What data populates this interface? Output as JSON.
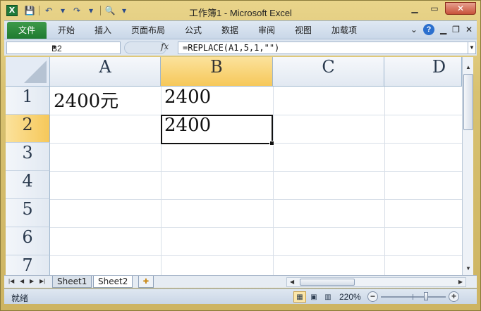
{
  "window": {
    "title": "工作簿1 - Microsoft Excel",
    "app_icon": "X"
  },
  "qat": {
    "save_icon": "💾",
    "undo_icon": "↶",
    "redo_icon": "↷",
    "preview_icon": "🔍"
  },
  "ribbon": {
    "tabs": [
      "文件",
      "开始",
      "插入",
      "页面布局",
      "公式",
      "数据",
      "审阅",
      "视图",
      "加载项"
    ],
    "help": "?"
  },
  "formula_bar": {
    "name_box": "B2",
    "fx_label": "fx",
    "formula": "=REPLACE(A1,5,1,\"\")"
  },
  "grid": {
    "columns": [
      "A",
      "B",
      "C",
      "D"
    ],
    "selected_column": "B",
    "rows": [
      "1",
      "2",
      "3",
      "4",
      "5",
      "6",
      "7"
    ],
    "selected_row": "2",
    "cells": {
      "A1": "2400元",
      "B1": "2400",
      "B2": "2400"
    }
  },
  "sheets": {
    "tabs": [
      "Sheet1",
      "Sheet2"
    ],
    "active": "Sheet2"
  },
  "status": {
    "ready": "就绪",
    "zoom": "220%",
    "zoom_minus": "−",
    "zoom_plus": "+"
  },
  "colors": {
    "selected_header": "#f6c85a",
    "file_tab": "#1f7a30",
    "title_bar": "#d8c170"
  }
}
